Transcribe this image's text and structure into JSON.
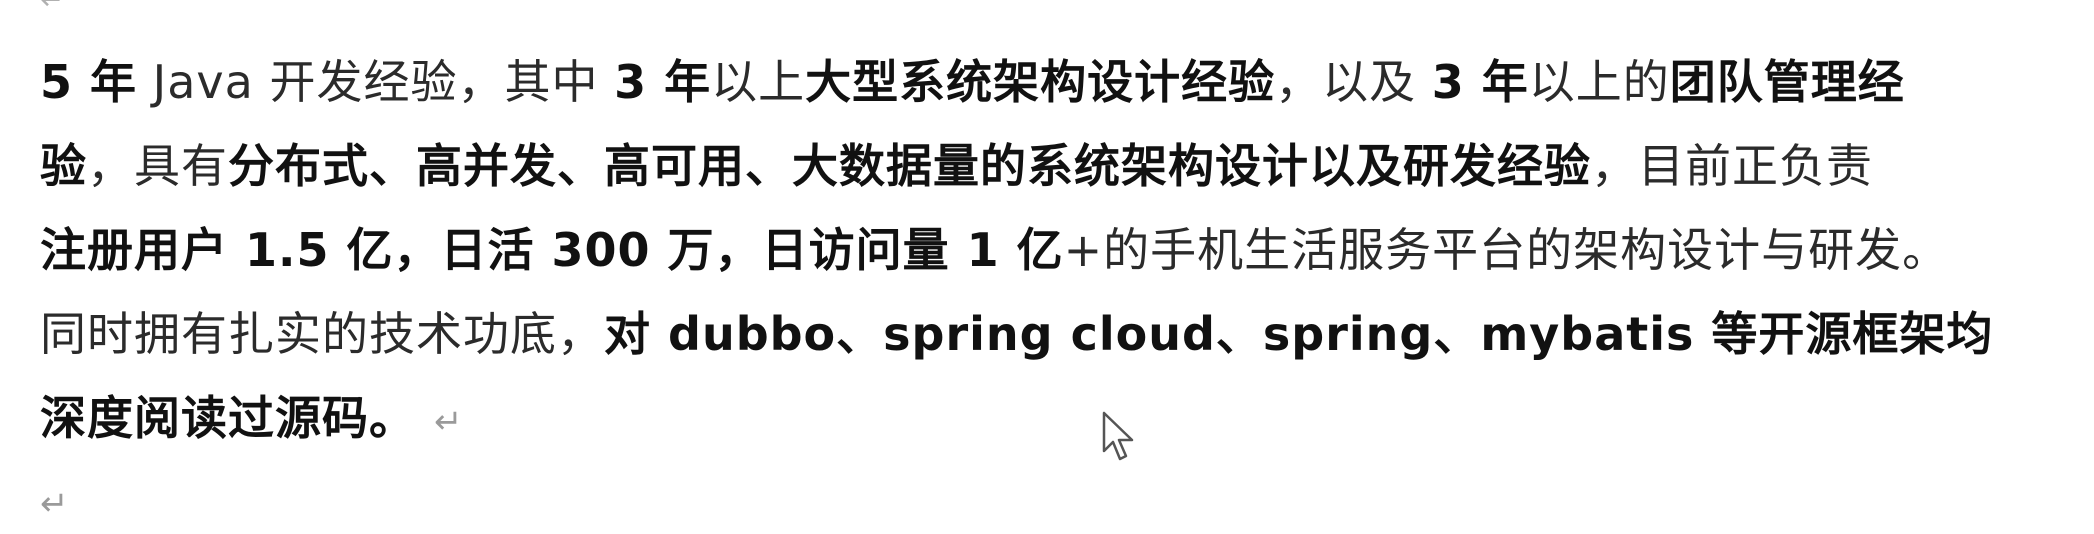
{
  "document": {
    "lines": [
      [
        {
          "t": "5 年",
          "b": true
        },
        {
          "t": " Java 开发经验，其中 ",
          "b": false
        },
        {
          "t": "3 年",
          "b": true
        },
        {
          "t": "以上",
          "b": false
        },
        {
          "t": "大型系统架构设计经验",
          "b": true
        },
        {
          "t": "，以及 ",
          "b": false
        },
        {
          "t": "3 年",
          "b": true
        },
        {
          "t": "以上的",
          "b": false
        },
        {
          "t": "团队管理经",
          "b": true
        }
      ],
      [
        {
          "t": "验",
          "b": true
        },
        {
          "t": "，具有",
          "b": false
        },
        {
          "t": "分布式、高并发、高可用、大数据量的系统架构设计以及研发经验",
          "b": true
        },
        {
          "t": "，目前正负责",
          "b": false
        }
      ],
      [
        {
          "t": "注册用户 1.5 亿，日活 300 万，日访问量 1 亿",
          "b": true
        },
        {
          "t": "+的手机生活服务平台的架构设计与研发。",
          "b": false
        }
      ],
      [
        {
          "t": "同时拥有扎实的技术功底，",
          "b": false
        },
        {
          "t": "对 dubbo、spring cloud、spring、mybatis 等开源框架均",
          "b": true
        }
      ],
      [
        {
          "t": "深度阅读过源码。",
          "b": true
        }
      ]
    ],
    "paragraph_mark": "↵",
    "empty_paragraph_mark": "↵"
  }
}
